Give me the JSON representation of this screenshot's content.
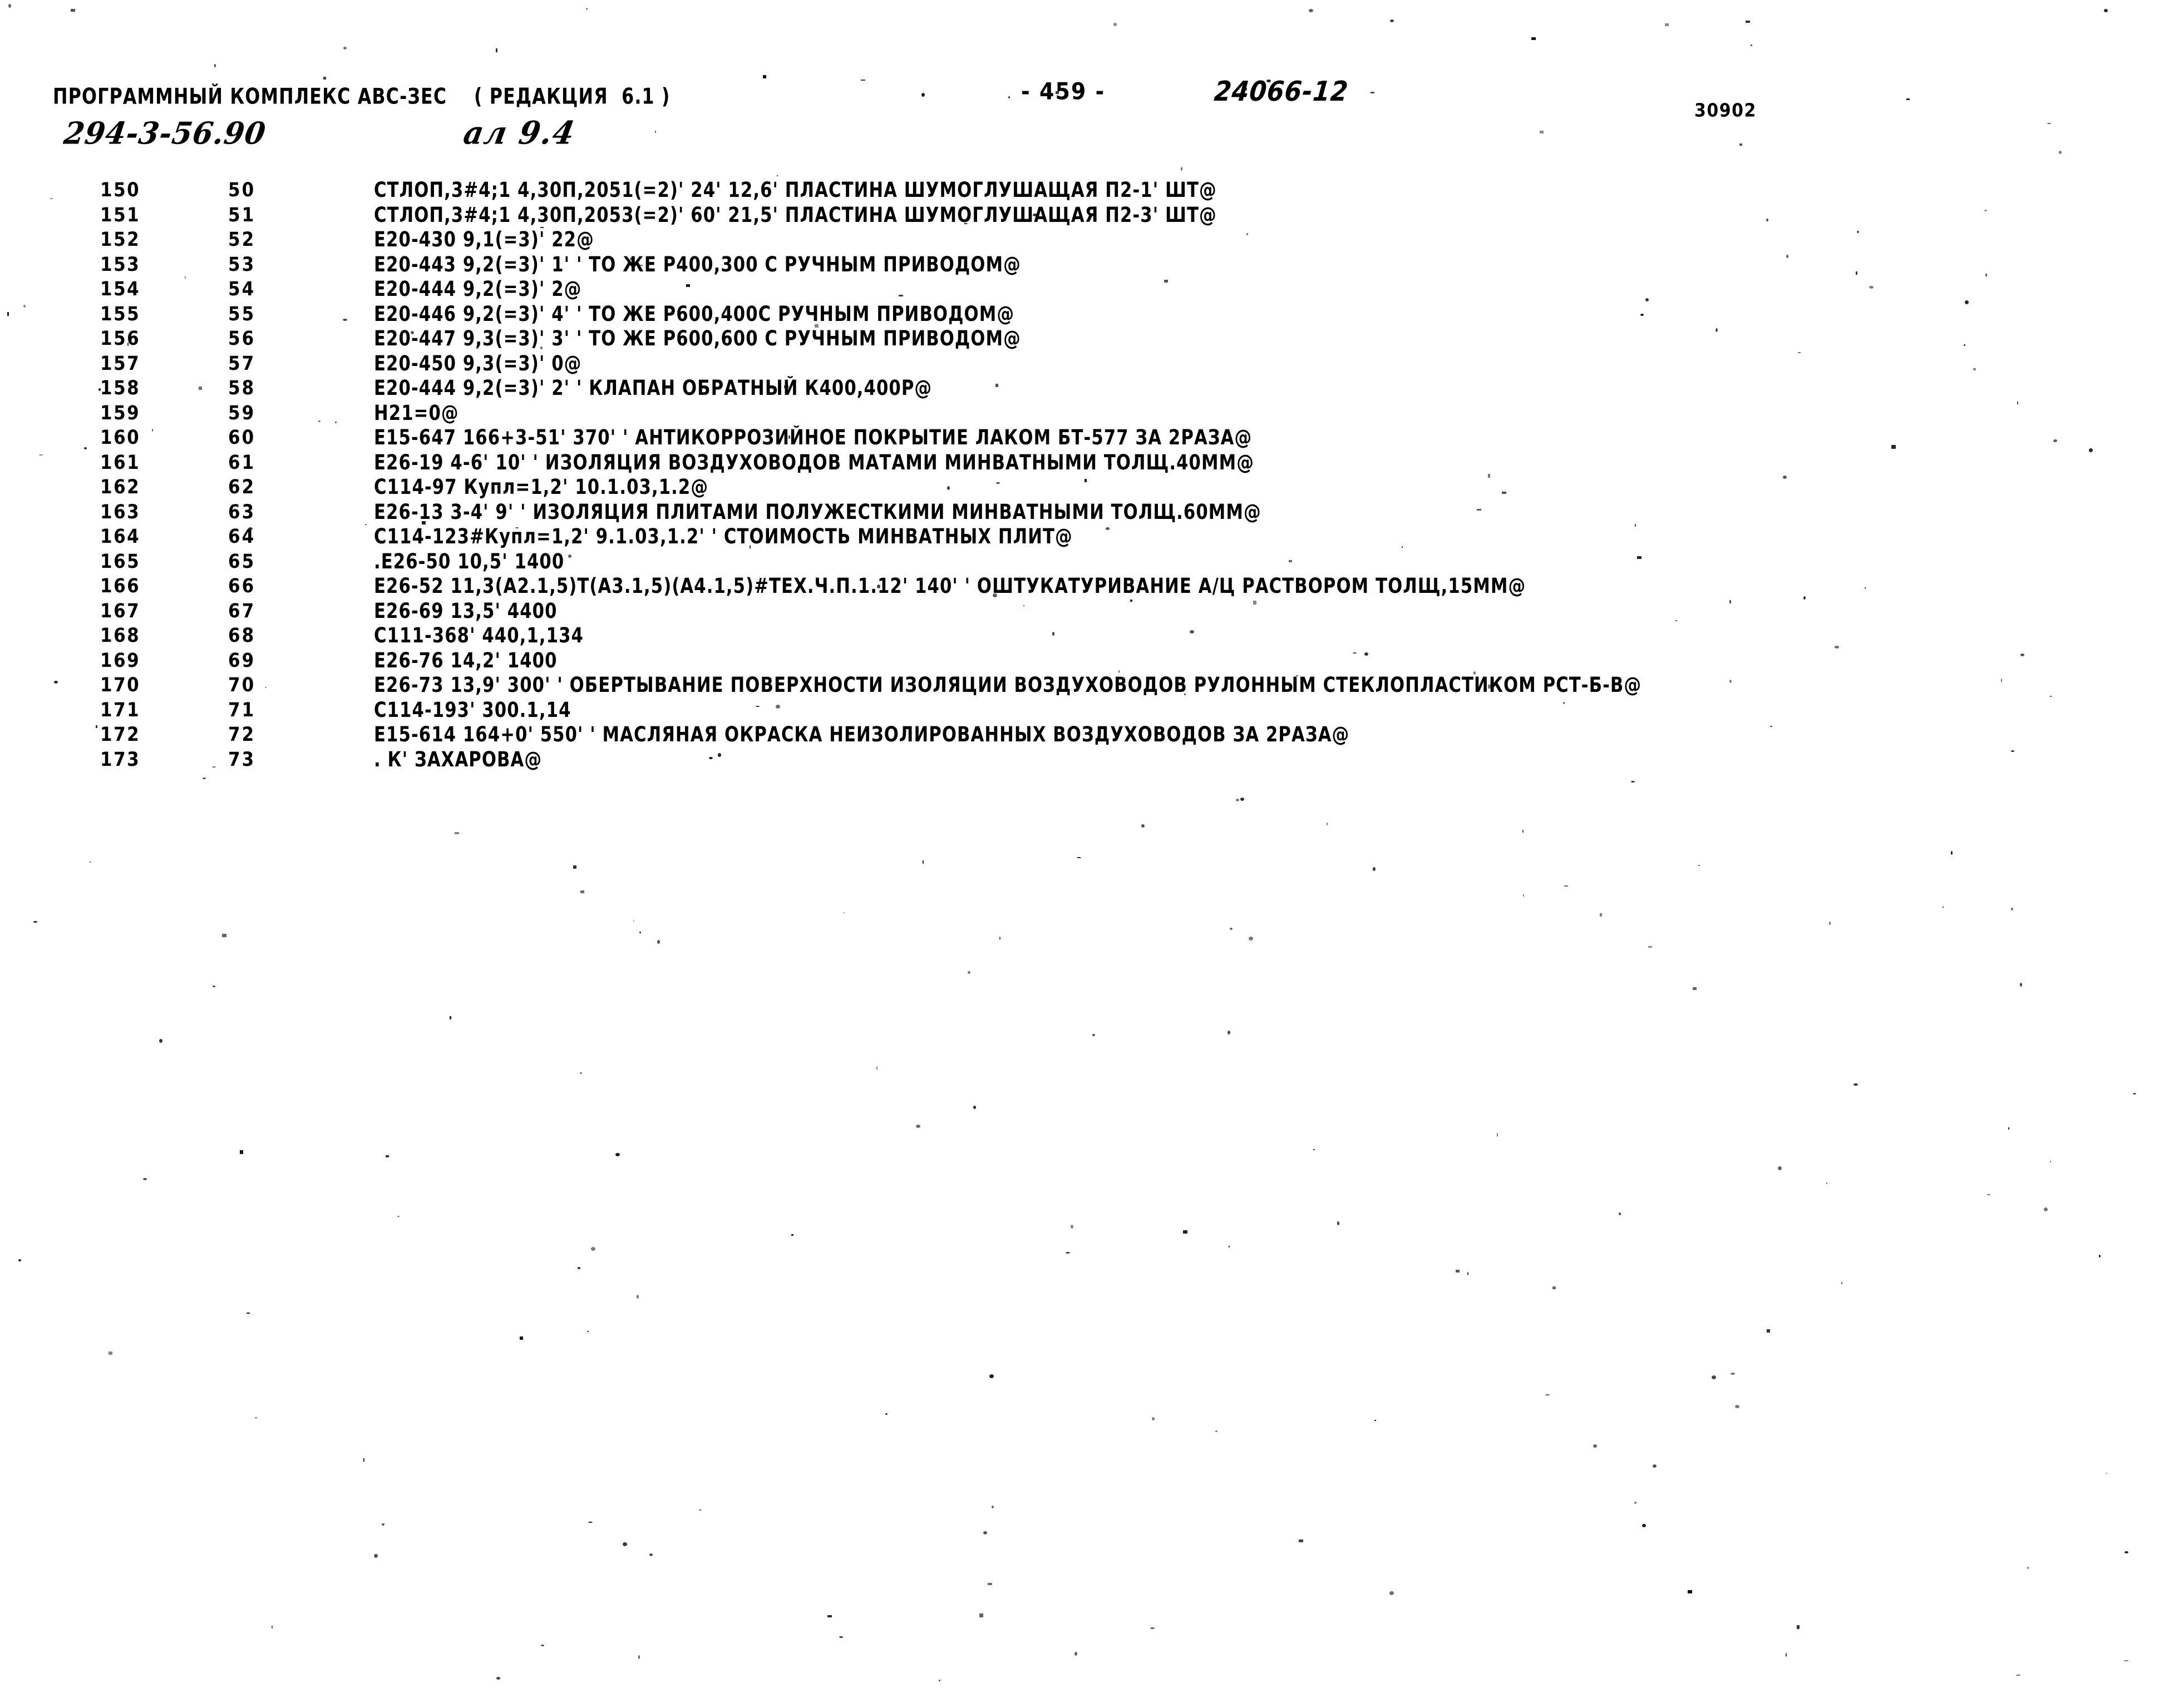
{
  "header": {
    "program_line": "ПРОГРАММНЫЙ КОМПЛЕКС АВС-ЗЕС    ( РЕДАКЦИЯ  6.1 )",
    "page_number": "- 459 -",
    "document_number": "24066-12",
    "right_code": "30902",
    "handwritten_code": "294-3-56.90",
    "handwritten_sheet": "ал 9.4"
  },
  "listing": {
    "columns": [
      "line_no",
      "index_no",
      "statement"
    ],
    "rows": [
      {
        "line_no": "150",
        "index_no": "50",
        "statement": "СТЛОП,3#4;1 4,30П,2051(=2)' 24' 12,6' ПЛАСТИНА ШУМОГЛУШАЩАЯ П2-1' ШТ@"
      },
      {
        "line_no": "151",
        "index_no": "51",
        "statement": "СТЛОП,3#4;1 4,30П,2053(=2)' 60' 21,5' ПЛАСТИНА ШУМОГЛУШАЩАЯ П2-3' ШТ@"
      },
      {
        "line_no": "152",
        "index_no": "52",
        "statement": "Е20-430 9,1(=3)' 22@"
      },
      {
        "line_no": "153",
        "index_no": "53",
        "statement": "Е20-443 9,2(=3)' 1' ' ТО ЖЕ Р400,300 С РУЧНЫМ ПРИВОДОМ@"
      },
      {
        "line_no": "154",
        "index_no": "54",
        "statement": "Е20-444 9,2(=3)' 2@"
      },
      {
        "line_no": "155",
        "index_no": "55",
        "statement": "Е20-446 9,2(=3)' 4' ' ТО ЖЕ Р600,400С РУЧНЫМ ПРИВОДОМ@"
      },
      {
        "line_no": "156",
        "index_no": "56",
        "statement": "Е20-447 9,3(=3)' 3' ' ТО ЖЕ Р600,600 С РУЧНЫМ ПРИВОДОМ@"
      },
      {
        "line_no": "157",
        "index_no": "57",
        "statement": "Е20-450 9,3(=3)' 0@"
      },
      {
        "line_no": "158",
        "index_no": "58",
        "statement": "Е20-444 9,2(=3)' 2' ' КЛАПАН ОБРАТНЫЙ К400,400Р@"
      },
      {
        "line_no": "159",
        "index_no": "59",
        "statement": "Н21=0@"
      },
      {
        "line_no": "160",
        "index_no": "60",
        "statement": "Е15-647 166+3-51' 370' ' АНТИКОРРОЗИЙНОЕ ПОКРЫТИЕ ЛАКОМ БТ-577 ЗА 2РАЗА@"
      },
      {
        "line_no": "161",
        "index_no": "61",
        "statement": "Е26-19 4-6' 10' ' ИЗОЛЯЦИЯ ВОЗДУХОВОДОВ МАТАМИ МИНВАТНЫМИ ТОЛЩ.40ММ@"
      },
      {
        "line_no": "162",
        "index_no": "62",
        "statement": "С114-97 Купл=1,2' 10.1.03,1.2@"
      },
      {
        "line_no": "163",
        "index_no": "63",
        "statement": "Е26-13 3-4' 9' ' ИЗОЛЯЦИЯ ПЛИТАМИ ПОЛУЖЕСТКИМИ МИНВАТНЫМИ ТОЛЩ.60ММ@"
      },
      {
        "line_no": "164",
        "index_no": "64",
        "statement": "С114-123#Купл=1,2' 9.1.03,1.2' ' СТОИМОСТЬ МИНВАТНЫХ ПЛИТ@"
      },
      {
        "line_no": "165",
        "index_no": "65",
        "statement": ".Е26-50 10,5' 1400"
      },
      {
        "line_no": "166",
        "index_no": "66",
        "statement": "Е26-52 11,3(А2.1,5)Т(А3.1,5)(А4.1,5)#ТЕХ.Ч.П.1.12' 140' ' ОШТУКАТУРИВАНИЕ А/Ц РАСТВОРОМ ТОЛЩ,15ММ@"
      },
      {
        "line_no": "167",
        "index_no": "67",
        "statement": "Е26-69 13,5' 4400"
      },
      {
        "line_no": "168",
        "index_no": "68",
        "statement": "С111-368' 440,1,134"
      },
      {
        "line_no": "169",
        "index_no": "69",
        "statement": "Е26-76 14,2' 1400"
      },
      {
        "line_no": "170",
        "index_no": "70",
        "statement": "Е26-73 13,9' 300' ' ОБЕРТЫВАНИЕ ПОВЕРХНОСТИ ИЗОЛЯЦИИ ВОЗДУХОВОДОВ РУЛОННЫМ СТЕКЛОПЛАСТИКОМ РСТ-Б-В@"
      },
      {
        "line_no": "171",
        "index_no": "71",
        "statement": "С114-193' 300.1,14"
      },
      {
        "line_no": "172",
        "index_no": "72",
        "statement": "Е15-614 164+0' 550' ' МАСЛЯНАЯ ОКРАСКА НЕИЗОЛИРОВАННЫХ ВОЗДУХОВОДОВ ЗА 2РАЗА@"
      },
      {
        "line_no": "173",
        "index_no": "73",
        "statement": ". К' ЗАХАРОВА@"
      }
    ]
  }
}
